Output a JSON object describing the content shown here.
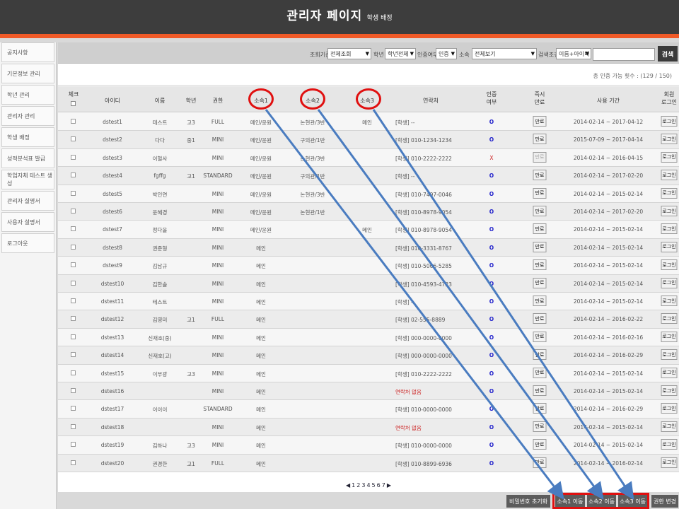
{
  "header": {
    "title": "관리자 페이지",
    "subtitle": "학생 배정"
  },
  "sidebar": {
    "items": [
      {
        "label": "공지사항"
      },
      {
        "label": "기본정보 관리"
      },
      {
        "label": "학년 관리"
      },
      {
        "label": "관리자 관리"
      },
      {
        "label": "학생 배정"
      },
      {
        "label": "성적분석표 발급"
      },
      {
        "label": "학업자체 테스트 생성"
      },
      {
        "label": "관리자 설명서"
      },
      {
        "label": "사용자 설명서"
      },
      {
        "label": "로그아웃"
      }
    ]
  },
  "search": {
    "criteria_label": "조회기준",
    "criteria_value": "전체조회",
    "grade_label": "학년",
    "grade_value": "학년전체",
    "auth_label": "인증여부",
    "auth_value": "인증",
    "affil_label": "소속",
    "affil_value": "전체보기",
    "cond_label": "검색조건",
    "cond_value": "이름+아이디",
    "input_value": "",
    "button": "검색"
  },
  "count_text": "총 인증 가능 횟수 : (129 / 150)",
  "table": {
    "headers": {
      "check": "체크",
      "id": "아이디",
      "name": "이름",
      "grade": "학년",
      "perm": "권한",
      "aff1": "소속1",
      "aff2": "소속2",
      "aff3": "소속3",
      "contact": "연락처",
      "auth1": "인증",
      "auth2": "여부",
      "expire1": "즉시",
      "expire2": "만료",
      "period": "사용 기간",
      "login1": "회원",
      "login2": "로그인"
    },
    "rows": [
      {
        "id": "dstest1",
        "name": "테스트",
        "grade": "고3",
        "perm": "FULL",
        "aff1": "메인/윤원",
        "aff2": "논현관/3반",
        "aff3": "메인",
        "contact": "[학생] --",
        "auth": "O",
        "expire": "만료",
        "period": "2014-02-14 ~ 2017-04-12",
        "login": "로그인"
      },
      {
        "id": "dstest2",
        "name": "다다",
        "grade": "중1",
        "perm": "MINI",
        "aff1": "메인/윤원",
        "aff2": "구의관/1반",
        "aff3": "",
        "contact": "[학생] 010-1234-1234",
        "auth": "O",
        "expire": "만료",
        "period": "2015-07-09 ~ 2017-04-14",
        "login": "로그인"
      },
      {
        "id": "dstest3",
        "name": "이혈사",
        "grade": "",
        "perm": "MINI",
        "aff1": "메인/윤원",
        "aff2": "논현관/3반",
        "aff3": "",
        "contact": "[학생] 010-2222-2222",
        "auth": "X",
        "expire": "만료",
        "period": "2014-02-14 ~ 2016-04-15",
        "login": "로그인"
      },
      {
        "id": "dstest4",
        "name": "fgffg",
        "grade": "고1",
        "perm": "STANDARD",
        "aff1": "메인/윤원",
        "aff2": "구의관/1반",
        "aff3": "",
        "contact": "[학생] --",
        "auth": "O",
        "expire": "만료",
        "period": "2014-02-14 ~ 2017-02-20",
        "login": "로그인"
      },
      {
        "id": "dstest5",
        "name": "박인연",
        "grade": "",
        "perm": "MINI",
        "aff1": "메인/윤원",
        "aff2": "논현관/3반",
        "aff3": "",
        "contact": "[학생] 010-7497-0046",
        "auth": "O",
        "expire": "만료",
        "period": "2014-02-14 ~ 2015-02-14",
        "login": "로그인"
      },
      {
        "id": "dstest6",
        "name": "윤혜경",
        "grade": "",
        "perm": "MINI",
        "aff1": "메인/윤원",
        "aff2": "논현관/1반",
        "aff3": "",
        "contact": "[학생] 010-8978-9054",
        "auth": "O",
        "expire": "만료",
        "period": "2014-02-14 ~ 2017-02-20",
        "login": "로그인"
      },
      {
        "id": "dstest7",
        "name": "정다을",
        "grade": "",
        "perm": "MINI",
        "aff1": "메인/윤원",
        "aff2": "",
        "aff3": "메인",
        "contact": "[학생] 010-8978-9054",
        "auth": "O",
        "expire": "만료",
        "period": "2014-02-14 ~ 2015-02-14",
        "login": "로그인"
      },
      {
        "id": "dstest8",
        "name": "권준형",
        "grade": "",
        "perm": "MINI",
        "aff1": "메인",
        "aff2": "",
        "aff3": "",
        "contact": "[학생] 010-3331-8767",
        "auth": "O",
        "expire": "만료",
        "period": "2014-02-14 ~ 2015-02-14",
        "login": "로그인"
      },
      {
        "id": "dstest9",
        "name": "김남규",
        "grade": "",
        "perm": "MINI",
        "aff1": "메인",
        "aff2": "",
        "aff3": "",
        "contact": "[학생] 010-5066-5285",
        "auth": "O",
        "expire": "만료",
        "period": "2014-02-14 ~ 2015-02-14",
        "login": "로그인"
      },
      {
        "id": "dstest10",
        "name": "김한솔",
        "grade": "",
        "perm": "MINI",
        "aff1": "메인",
        "aff2": "",
        "aff3": "",
        "contact": "[학생] 010-4593-4723",
        "auth": "O",
        "expire": "만료",
        "period": "2014-02-14 ~ 2015-02-14",
        "login": "로그인"
      },
      {
        "id": "dstest11",
        "name": "테스트",
        "grade": "",
        "perm": "MINI",
        "aff1": "메인",
        "aff2": "",
        "aff3": "",
        "contact": "[학생] --",
        "auth": "O",
        "expire": "만료",
        "period": "2014-02-14 ~ 2015-02-14",
        "login": "로그인"
      },
      {
        "id": "dstest12",
        "name": "김영미",
        "grade": "고1",
        "perm": "FULL",
        "aff1": "메인",
        "aff2": "",
        "aff3": "",
        "contact": "[학생] 02-555-8889",
        "auth": "O",
        "expire": "만료",
        "period": "2014-02-14 ~ 2016-02-22",
        "login": "로그인"
      },
      {
        "id": "dstest13",
        "name": "신재호(중)",
        "grade": "",
        "perm": "MINI",
        "aff1": "메인",
        "aff2": "",
        "aff3": "",
        "contact": "[학생] 000-0000-0000",
        "auth": "O",
        "expire": "만료",
        "period": "2014-02-14 ~ 2016-02-16",
        "login": "로그인"
      },
      {
        "id": "dstest14",
        "name": "신재호(고)",
        "grade": "",
        "perm": "MINI",
        "aff1": "메인",
        "aff2": "",
        "aff3": "",
        "contact": "[학생] 000-0000-0000",
        "auth": "O",
        "expire": "만료",
        "period": "2014-02-14 ~ 2016-02-29",
        "login": "로그인"
      },
      {
        "id": "dstest15",
        "name": "이부광",
        "grade": "고3",
        "perm": "MINI",
        "aff1": "메인",
        "aff2": "",
        "aff3": "",
        "contact": "[학생] 010-2222-2222",
        "auth": "O",
        "expire": "만료",
        "period": "2014-02-14 ~ 2015-02-14",
        "login": "로그인"
      },
      {
        "id": "dstest16",
        "name": "",
        "grade": "",
        "perm": "MINI",
        "aff1": "메인",
        "aff2": "",
        "aff3": "",
        "contact": "연락처 없음",
        "contact_missing": true,
        "auth": "O",
        "expire": "만료",
        "period": "2014-02-14 ~ 2015-02-14",
        "login": "로그인"
      },
      {
        "id": "dstest17",
        "name": "이이이",
        "grade": "",
        "perm": "STANDARD",
        "aff1": "메인",
        "aff2": "",
        "aff3": "",
        "contact": "[학생] 010-0000-0000",
        "auth": "O",
        "expire": "만료",
        "period": "2014-02-14 ~ 2016-02-29",
        "login": "로그인"
      },
      {
        "id": "dstest18",
        "name": "",
        "grade": "",
        "perm": "MINI",
        "aff1": "메인",
        "aff2": "",
        "aff3": "",
        "contact": "연락처 없음",
        "contact_missing": true,
        "auth": "O",
        "expire": "만료",
        "period": "2014-02-14 ~ 2015-02-14",
        "login": "로그인"
      },
      {
        "id": "dstest19",
        "name": "김하나",
        "grade": "고3",
        "perm": "MINI",
        "aff1": "메인",
        "aff2": "",
        "aff3": "",
        "contact": "[학생] 010-0000-0000",
        "auth": "O",
        "expire": "만료",
        "period": "2014-02-14 ~ 2015-02-14",
        "login": "로그인"
      },
      {
        "id": "dstest20",
        "name": "권경한",
        "grade": "고1",
        "perm": "FULL",
        "aff1": "메인",
        "aff2": "",
        "aff3": "",
        "contact": "[학생] 010-8899-6936",
        "auth": "O",
        "expire": "만료",
        "period": "2014-02-14 ~ 2016-02-14",
        "login": "로그인"
      }
    ]
  },
  "pagination": {
    "prev": "◀",
    "pages": [
      "1",
      "2",
      "3",
      "4",
      "5",
      "6",
      "7"
    ],
    "next": "▶"
  },
  "bottom": {
    "reset_pw": "비밀번호 초기화",
    "move1": "소속1 이동",
    "move2": "소속2 이동",
    "move3": "소속3 이동",
    "perm_change": "권한 변경"
  },
  "colors": {
    "header_bg": "#3d3d3d",
    "accent": "#f05a28",
    "annotation_red": "#e01010",
    "annotation_arrow": "#4a7cc0"
  }
}
